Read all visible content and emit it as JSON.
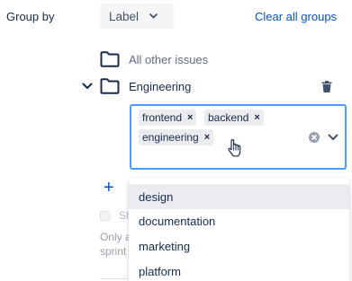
{
  "header": {
    "group_by_label": "Group by",
    "group_select_value": "Label",
    "clear_all_label": "Clear all groups"
  },
  "groups": {
    "other": {
      "label": "All other issues"
    },
    "engineering": {
      "label": "Engineering"
    }
  },
  "multi_select": {
    "chips": [
      {
        "label": "frontend",
        "remove": "×"
      },
      {
        "label": "backend",
        "remove": "×"
      },
      {
        "label": "engineering",
        "remove": "×"
      }
    ]
  },
  "options": [
    {
      "label": "design",
      "highlighted": true
    },
    {
      "label": "documentation",
      "highlighted": false
    },
    {
      "label": "marketing",
      "highlighted": false
    },
    {
      "label": "platform",
      "highlighted": false
    }
  ],
  "footer": {
    "add_symbol": "+",
    "checkbox_text_partial": "Sh",
    "note_line1": "Only a",
    "note_line2": "sprint"
  },
  "colors": {
    "accent": "#0052cc",
    "focus_border": "#4c9aff",
    "chip_bg": "#ebecf0",
    "text": "#172b4d",
    "muted": "#5e6c84"
  }
}
